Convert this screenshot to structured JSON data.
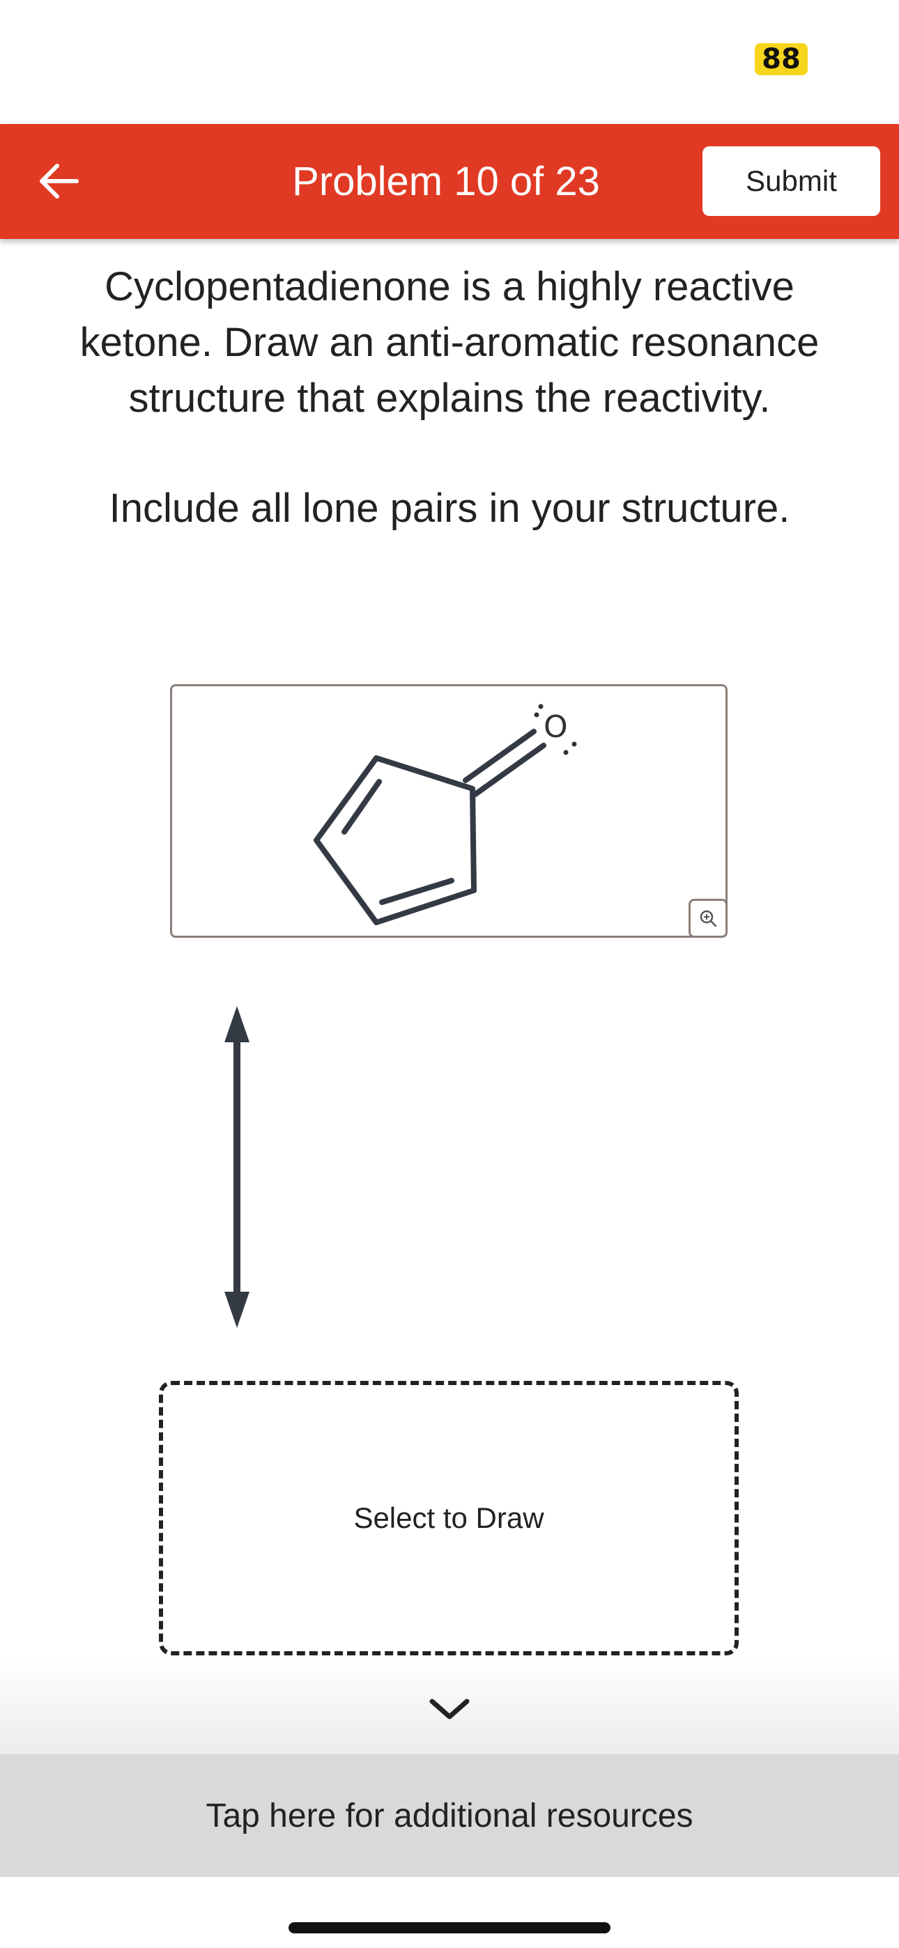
{
  "status_bar": {
    "battery_level": "88",
    "battery_color": "#f7d51d"
  },
  "header": {
    "title": "Problem 10 of 23",
    "submit_label": "Submit",
    "background_color": "#e03a24",
    "back_icon": "arrow-left-icon"
  },
  "question": {
    "text": "Cyclopentadienone is a highly reactive ketone. Draw an anti-aromatic resonance structure that explains the reactivity.",
    "instruction": "Include all lone pairs in your structure."
  },
  "structure": {
    "oxygen_label": "O",
    "zoom_icon": "zoom-in-icon"
  },
  "resonance_arrow_icon": "double-headed-arrow-icon",
  "draw_area": {
    "label": "Select to Draw"
  },
  "footer": {
    "expand_icon": "chevron-down-icon",
    "resources_label": "Tap here for additional resources"
  }
}
